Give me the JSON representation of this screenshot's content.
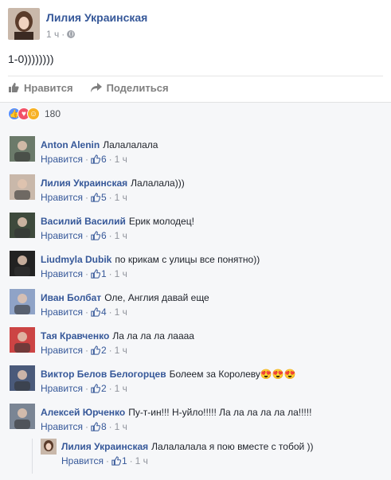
{
  "post": {
    "author": "Лилия Украинская",
    "time": "1 ч",
    "text": "1-0))))))))",
    "like_label": "Нравится",
    "share_label": "Поделиться",
    "reaction_count": "180"
  },
  "comments": [
    {
      "name": "Anton Alenin",
      "text": "Лалалалала",
      "likes": "6",
      "time": "1 ч",
      "like_label": "Нравится"
    },
    {
      "name": "Лилия Украинская",
      "text": "Лалалала)))",
      "likes": "5",
      "time": "1 ч",
      "like_label": "Нравится"
    },
    {
      "name": "Василий Василий",
      "text": "Ерик молодец!",
      "likes": "6",
      "time": "1 ч",
      "like_label": "Нравится"
    },
    {
      "name": "Liudmyla Dubik",
      "text": "по крикам с улицы все понятно))",
      "likes": "1",
      "time": "1 ч",
      "like_label": "Нравится"
    },
    {
      "name": "Иван Болбат",
      "text": "Оле, Англия давай еще",
      "likes": "4",
      "time": "1 ч",
      "like_label": "Нравится"
    },
    {
      "name": "Тая Кравченко",
      "text": "Ла ла ла ла лаааа",
      "likes": "2",
      "time": "1 ч",
      "like_label": "Нравится"
    },
    {
      "name": "Виктор Белов Белогорцев",
      "text": "Болеем за Королеву😍😍😍",
      "likes": "2",
      "time": "1 ч",
      "like_label": "Нравится"
    },
    {
      "name": "Алексей Юрченко",
      "text": "Пу-т-ин!!! Н-уйло!!!!! Ла ла ла ла ла ла!!!!!",
      "likes": "8",
      "time": "1 ч",
      "like_label": "Нравится"
    }
  ],
  "reply": {
    "name": "Лилия Украинская",
    "text": "Лалалалала я пою вместе с тобой ))",
    "likes": "1",
    "time": "1 ч",
    "like_label": "Нравится"
  },
  "colors": {
    "link": "#365899",
    "meta": "#90949c",
    "bg": "#f6f7f9"
  }
}
